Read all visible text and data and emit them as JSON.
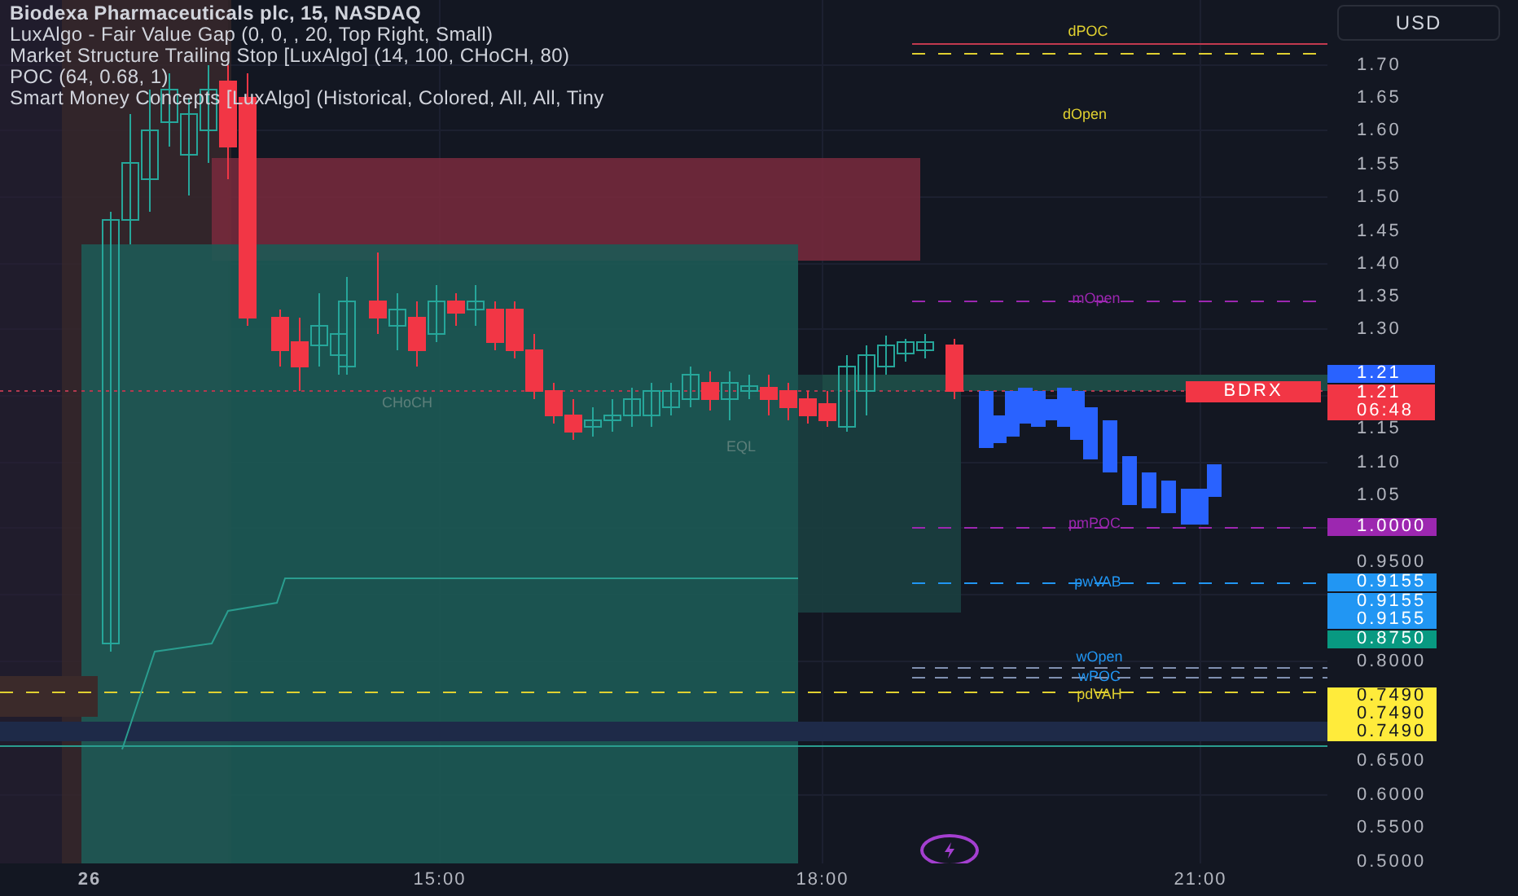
{
  "legend": {
    "title": "Biodexa Pharmaceuticals plc, 15, NASDAQ",
    "indicators": [
      "LuxAlgo - Fair Value Gap (0, 0, , 20, Top Right, Small)",
      "Market Structure Trailing Stop [LuxAlgo] (14, 100, CHoCH, 80)",
      "POC (64, 0.68, 1)",
      "Smart Money Concepts [LuxAlgo] (Historical, Colored, All, All, Tiny"
    ]
  },
  "currency_button": "USD",
  "price_axis": {
    "ticks": [
      "1.70",
      "1.65",
      "1.60",
      "1.55",
      "1.50",
      "1.45",
      "1.40",
      "1.35",
      "1.30",
      "1.15",
      "1.10",
      "1.05",
      "0.9500",
      "0.8000",
      "0.6500",
      "0.6000",
      "0.5500",
      "0.5000"
    ]
  },
  "price_tags": [
    {
      "value": "1.21",
      "color": "#2962ff"
    },
    {
      "value": "1.21",
      "countdown": "06:48",
      "color": "#f23645"
    },
    {
      "value": "1.0000",
      "color": "#9c27b0"
    },
    {
      "value": "0.9155",
      "color": "#2196f3"
    },
    {
      "value": "0.9155",
      "color": "#2196f3"
    },
    {
      "value": "0.9155",
      "color": "#2196f3"
    },
    {
      "value": "0.8750",
      "color": "#089981"
    },
    {
      "value": "0.7490",
      "color": "#ffeb3b"
    },
    {
      "value": "0.7490",
      "color": "#ffeb3b"
    },
    {
      "value": "0.7490",
      "color": "#ffeb3b"
    }
  ],
  "symbol_tag": {
    "label": "BDRX",
    "color": "#f23645"
  },
  "chart_labels": [
    {
      "text": "dPOC",
      "color": "#e0d030"
    },
    {
      "text": "dOpen",
      "color": "#e0d030"
    },
    {
      "text": "mOpen",
      "color": "#9c27b0"
    },
    {
      "text": "CHoCH",
      "color": "#5d7f7a"
    },
    {
      "text": "EQL",
      "color": "#5d7f7a"
    },
    {
      "text": "pmPOC",
      "color": "#9c27b0"
    },
    {
      "text": "pwVAB",
      "color": "#2196f3"
    },
    {
      "text": "wOpen",
      "color": "#2196f3"
    },
    {
      "text": "wPOC",
      "color": "#2196f3"
    },
    {
      "text": "pdVAH",
      "color": "#e0d030"
    }
  ],
  "time_axis": [
    "26",
    "15:00",
    "18:00",
    "21:00"
  ]
}
